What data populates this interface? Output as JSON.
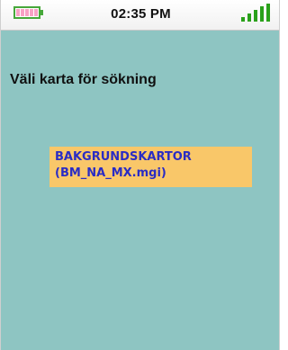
{
  "status_bar": {
    "time": "02:35 PM",
    "battery_icon": "battery-icon",
    "signal_icon": "signal-strength-icon",
    "accent_green": "#2aa11b"
  },
  "screen": {
    "prompt": "Väli karta för sökning",
    "background_color": "#8ec5c2"
  },
  "maps": [
    {
      "name": "BAKGRUNDSKARTOR",
      "file": "(BM_NA_MX.mgi)",
      "selected": true,
      "highlight_color": "#f9c769"
    }
  ]
}
